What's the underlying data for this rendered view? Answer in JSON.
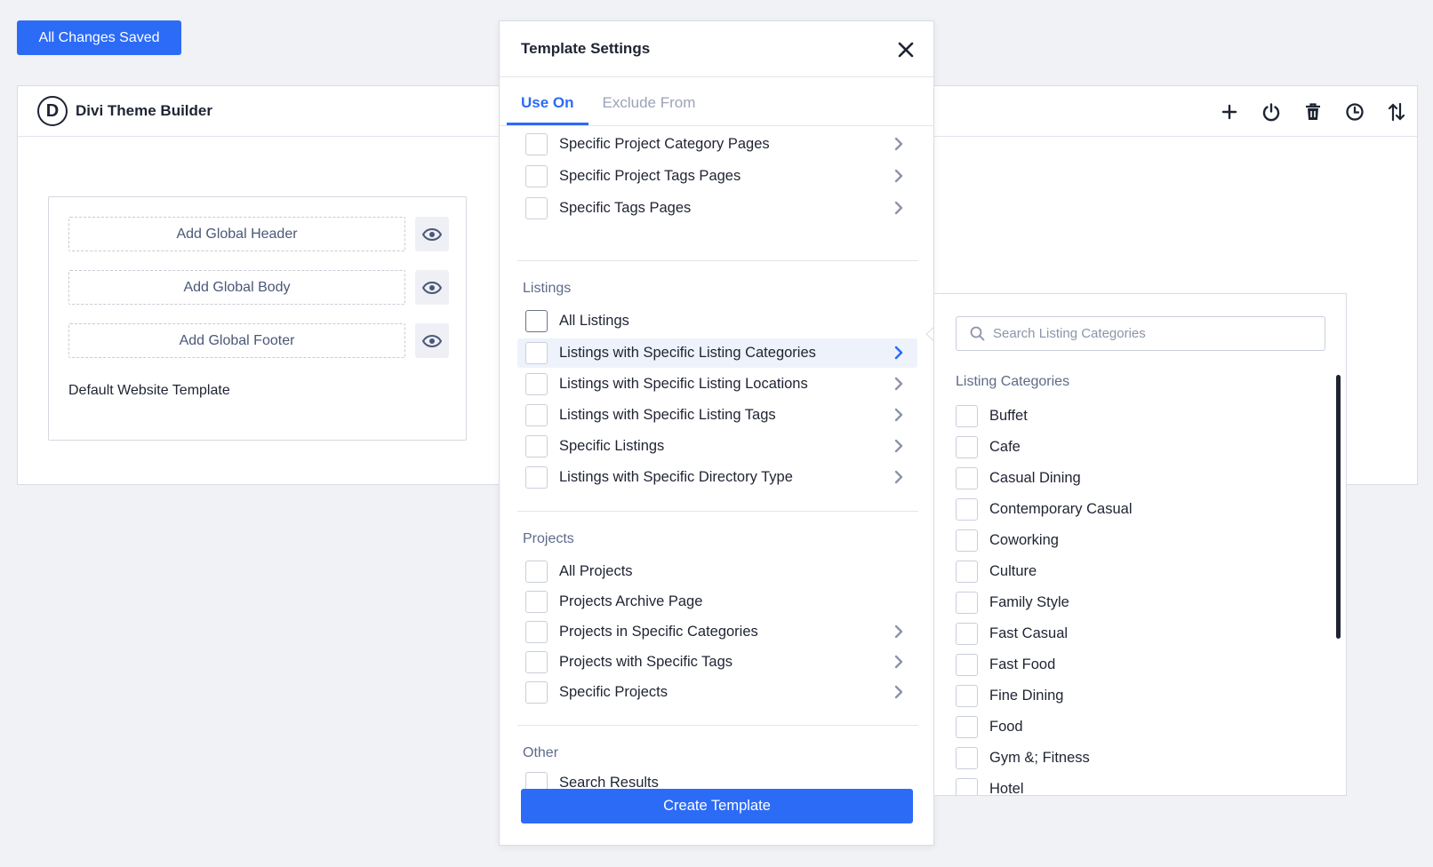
{
  "status_button": "All Changes Saved",
  "builder": {
    "title": "Divi Theme Builder",
    "logo_letter": "D",
    "toolbar": [
      "plus-icon",
      "power-icon",
      "trash-icon",
      "history-icon",
      "sort-icon"
    ]
  },
  "template_card": {
    "buttons": [
      "Add Global Header",
      "Add Global Body",
      "Add Global Footer"
    ],
    "name": "Default Website Template"
  },
  "modal": {
    "title": "Template Settings",
    "tabs": [
      "Use On",
      "Exclude From"
    ],
    "active_tab": "Use On",
    "top_items": [
      "Specific Project Category Pages",
      "Specific Project Tags Pages",
      "Specific Tags Pages"
    ],
    "sections": {
      "listings": "Listings",
      "projects": "Projects",
      "other": "Other"
    },
    "listing_items": [
      "All Listings",
      "Listings with Specific Listing Categories",
      "Listings with Specific Listing Locations",
      "Listings with Specific Listing Tags",
      "Specific Listings",
      "Listings with Specific Directory Type"
    ],
    "project_items": [
      "All Projects",
      "Projects Archive Page",
      "Projects in Specific Categories",
      "Projects with Specific Tags",
      "Specific Projects"
    ],
    "other_items": [
      "Search Results"
    ],
    "create_button": "Create Template"
  },
  "submenu": {
    "search_placeholder": "Search Listing Categories",
    "title": "Listing Categories",
    "categories": [
      "Buffet",
      "Cafe",
      "Casual Dining",
      "Contemporary Casual",
      "Coworking",
      "Culture",
      "Family Style",
      "Fast Casual",
      "Fast Food",
      "Fine Dining",
      "Food",
      "Gym &; Fitness",
      "Hotel"
    ]
  },
  "colors": {
    "accent": "#2c6bf6",
    "background": "#f1f2f6",
    "text": "#1f2433",
    "muted": "#5d6b8a"
  }
}
